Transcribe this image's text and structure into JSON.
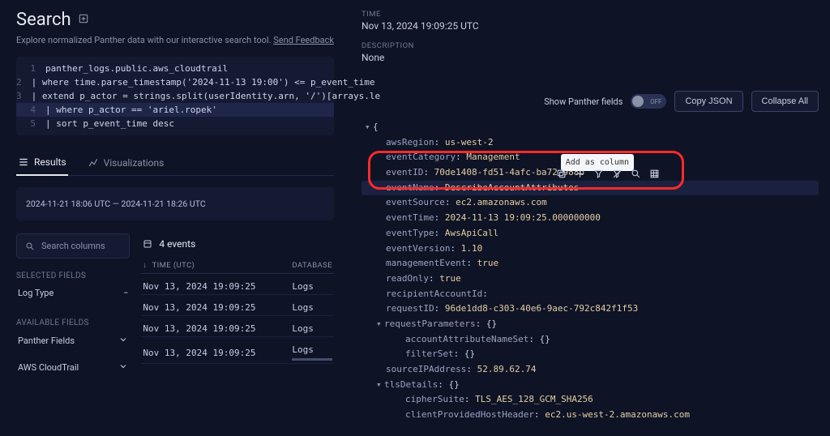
{
  "page": {
    "title": "Search",
    "subtitle": "Explore normalized Panther data with our interactive search tool.",
    "feedback_link": "Send Feedback"
  },
  "query": {
    "lines": [
      "panther_logs.public.aws_cloudtrail",
      "| where time.parse_timestamp('2024-11-13 19:00') <= p_event_time",
      "| extend p_actor = strings.split(userIdentity.arn, '/')[arrays.le",
      "| where p_actor == 'ariel.ropek'",
      "| sort p_event_time desc"
    ],
    "highlight_index": 3
  },
  "tabs": {
    "results": "Results",
    "viz": "Visualizations"
  },
  "time_range": "2024-11-21 18:06 UTC — 2024-11-21 18:26 UTC",
  "fields": {
    "search_placeholder": "Search columns",
    "selected_heading": "SELECTED FIELDS",
    "selected": [
      {
        "label": "Log Type"
      }
    ],
    "available_heading": "AVAILABLE FIELDS",
    "available": [
      {
        "label": "Panther Fields"
      },
      {
        "label": "AWS CloudTrail"
      }
    ]
  },
  "events": {
    "count_label": "4 events",
    "col_time": "TIME (UTC)",
    "col_db": "DATABASE",
    "rows": [
      {
        "time": "Nov 13, 2024 19:09:25",
        "db": "Logs"
      },
      {
        "time": "Nov 13, 2024 19:09:25",
        "db": "Logs"
      },
      {
        "time": "Nov 13, 2024 19:09:25",
        "db": "Logs"
      },
      {
        "time": "Nov 13, 2024 19:09:25",
        "db": "Logs"
      }
    ]
  },
  "detail": {
    "time_label": "TIME",
    "time_value": "Nov 13, 2024 19:09:25 UTC",
    "desc_label": "DESCRIPTION",
    "desc_value": "None",
    "toggle_label": "Show Panther fields",
    "toggle_state": "OFF",
    "btn_copy": "Copy JSON",
    "btn_collapse": "Collapse All",
    "tooltip": "Add as column",
    "json": [
      {
        "k": "awsRegion",
        "v": "us-west-2"
      },
      {
        "k": "eventCategory",
        "v": "Management"
      },
      {
        "k": "eventID",
        "v": "70de1408-fd51-4afc-ba72-988b"
      },
      {
        "k": "eventName",
        "v": "DescribeAccountAttributes"
      },
      {
        "k": "eventSource",
        "v": "ec2.amazonaws.com"
      },
      {
        "k": "eventTime",
        "v": "2024-11-13 19:09:25.000000000"
      },
      {
        "k": "eventType",
        "v": "AwsApiCall"
      },
      {
        "k": "eventVersion",
        "v": "1.10"
      },
      {
        "k": "managementEvent",
        "v": "true"
      },
      {
        "k": "readOnly",
        "v": "true"
      },
      {
        "k": "recipientAccountId",
        "v": ""
      },
      {
        "k": "requestID",
        "v": "96de1dd8-c303-40e6-9aec-792c842f1f53"
      }
    ],
    "nested": {
      "requestParameters_label": "requestParameters",
      "accountAttributeNameSet": "accountAttributeNameSet",
      "filterSet": "filterSet",
      "sourceIPAddress_k": "sourceIPAddress",
      "sourceIPAddress_v": "52.89.62.74",
      "tlsDetails_label": "tlsDetails",
      "cipherSuite_k": "cipherSuite",
      "cipherSuite_v": "TLS_AES_128_GCM_SHA256",
      "clientHost_k": "clientProvidedHostHeader",
      "clientHost_v": "ec2.us-west-2.amazonaws.com"
    }
  }
}
